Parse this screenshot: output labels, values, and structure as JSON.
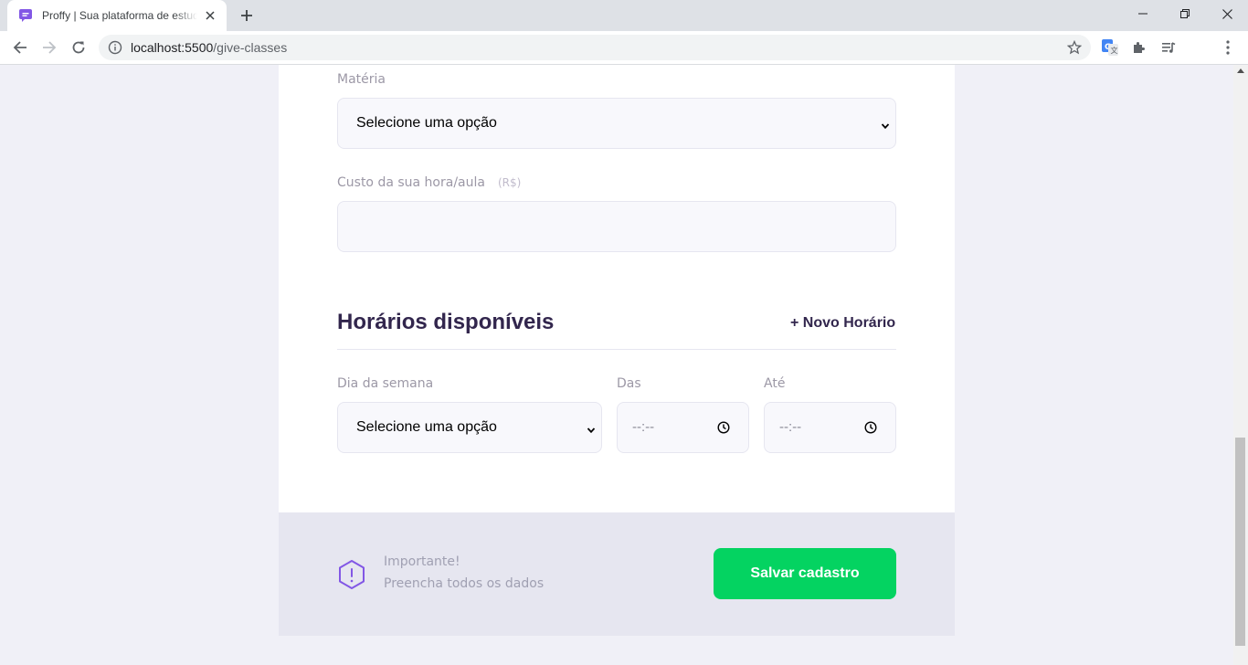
{
  "browser": {
    "tab_title": "Proffy | Sua plataforma de estudos",
    "url_host": "localhost:5500",
    "url_path": "/give-classes"
  },
  "colors": {
    "brand_purple": "#8257e5",
    "title_dark": "#32264d",
    "save_green": "#04d361",
    "warning_purple": "#8257e5"
  },
  "form": {
    "subject_label": "Matéria",
    "subject_value": "Selecione uma opção",
    "cost_label": "Custo da sua hora/aula",
    "cost_hint": "(R$)",
    "cost_value": ""
  },
  "schedule": {
    "title": "Horários disponíveis",
    "add_label": "+ Novo Horário",
    "weekday_label": "Dia da semana",
    "weekday_value": "Selecione uma opção",
    "from_label": "Das",
    "from_value": "--:--",
    "to_label": "Até",
    "to_value": "--:--"
  },
  "footer": {
    "warning_title": "Importante!",
    "warning_text": "Preencha todos os dados",
    "save_label": "Salvar cadastro",
    "warning_icon": "warning-hexagon-icon"
  }
}
